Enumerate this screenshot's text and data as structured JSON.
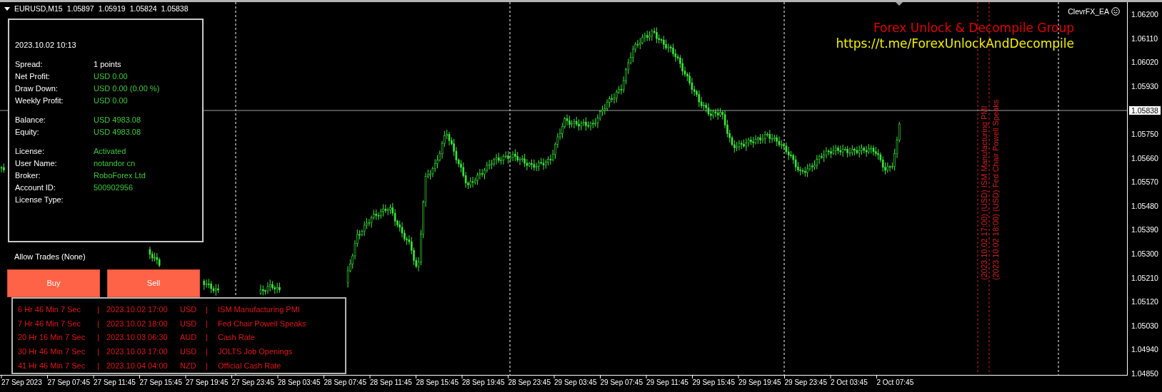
{
  "header": {
    "symbol": "EURUSD,M15",
    "quotes": [
      "1.05897",
      "1.05919",
      "1.05824",
      "1.05838"
    ]
  },
  "expert": {
    "name": "ClevrFX_EA"
  },
  "overlay_text": {
    "title": "Forex Unlock & Decompile Group",
    "link": "https://t.me/ForexUnlockAndDecompile"
  },
  "info_panel": {
    "timestamp": "2023.10.02 10:13",
    "groups": [
      {
        "rows": [
          {
            "label": "Spread:",
            "value": "1 points",
            "color": "#ffffff"
          },
          {
            "label": "Net Profit:",
            "value": "USD 0.00",
            "color": "#3cc83c"
          },
          {
            "label": "Draw Down:",
            "value": "USD 0.00 (0.00 %)",
            "color": "#3cc83c"
          },
          {
            "label": "Weekly Profit:",
            "value": "USD 0.00",
            "color": "#3cc83c"
          }
        ]
      },
      {
        "rows": [
          {
            "label": "Balance:",
            "value": "USD 4983.08",
            "color": "#3cc83c"
          },
          {
            "label": "Equity:",
            "value": "USD 4983.08",
            "color": "#3cc83c"
          }
        ]
      },
      {
        "rows": [
          {
            "label": "License:",
            "value": "Activated",
            "color": "#3cc83c"
          },
          {
            "label": "User Name:",
            "value": "notandor cn",
            "color": "#3cc83c"
          },
          {
            "label": "Broker:",
            "value": "RoboForex Ltd",
            "color": "#3cc83c"
          },
          {
            "label": "Account ID:",
            "value": "500902956",
            "color": "#3cc83c"
          },
          {
            "label": "License Type:"
          }
        ]
      }
    ]
  },
  "allow_trades": "Allow Trades (None)",
  "buttons": [
    "Buy",
    "Sell"
  ],
  "news": [
    {
      "countdown": "6 Hr 46 Min 7 Sec",
      "divider_1": "|",
      "datetime": "2023.10.02 17:00",
      "currency": "USD",
      "divider_2": "|",
      "event": "ISM Manufacturing PMI"
    },
    {
      "countdown": "7 Hr 46 Min 7 Sec",
      "divider_1": "|",
      "datetime": "2023.10.02 18:00",
      "currency": "USD",
      "divider_2": "|",
      "event": "Fed Chair Powell Speaks"
    },
    {
      "countdown": "20 Hr 16 Min 7 Sec",
      "divider_1": "|",
      "datetime": "2023.10.03 06:30",
      "currency": "AUD",
      "divider_2": "|",
      "event": "Cash Rate"
    },
    {
      "countdown": "30 Hr 46 Min 7 Sec",
      "divider_1": "|",
      "datetime": "2023.10.03 17:00",
      "currency": "USD",
      "divider_2": "|",
      "event": "JOLTS Job Openings"
    },
    {
      "countdown": "41 Hr 46 Min 7 Sec",
      "divider_1": "|",
      "datetime": "2023.10.04 04:00",
      "currency": "NZD",
      "divider_2": "|",
      "event": "Official Cash Rate"
    }
  ],
  "event_lines": [
    "(2023.10.02 17:00) (USD) ISM Manufacturing PMI",
    "(2023.10.02 18:00) (USD) Fed Chair Powell Speaks"
  ],
  "price_axis": {
    "ticks": [
      "1.06200",
      "1.06110",
      "1.06020",
      "1.05930",
      "1.05750",
      "1.05660",
      "1.05570",
      "1.05480",
      "1.05390",
      "1.05300",
      "1.05210",
      "1.05120",
      "1.05030",
      "1.04940",
      "1.04850"
    ],
    "current_price": "1.05838"
  },
  "time_axis": [
    "27 Sep 2023",
    "27 Sep 07:45",
    "27 Sep 11:45",
    "27 Sep 15:45",
    "27 Sep 19:45",
    "27 Sep 23:45",
    "28 Sep 03:45",
    "28 Sep 07:45",
    "28 Sep 11:45",
    "28 Sep 15:45",
    "28 Sep 19:45",
    "28 Sep 23:45",
    "29 Sep 03:45",
    "29 Sep 07:45",
    "29 Sep 11:45",
    "29 Sep 15:45",
    "29 Sep 19:45",
    "29 Sep 23:45",
    "2 Oct 03:45",
    "2 Oct 07:45"
  ]
}
